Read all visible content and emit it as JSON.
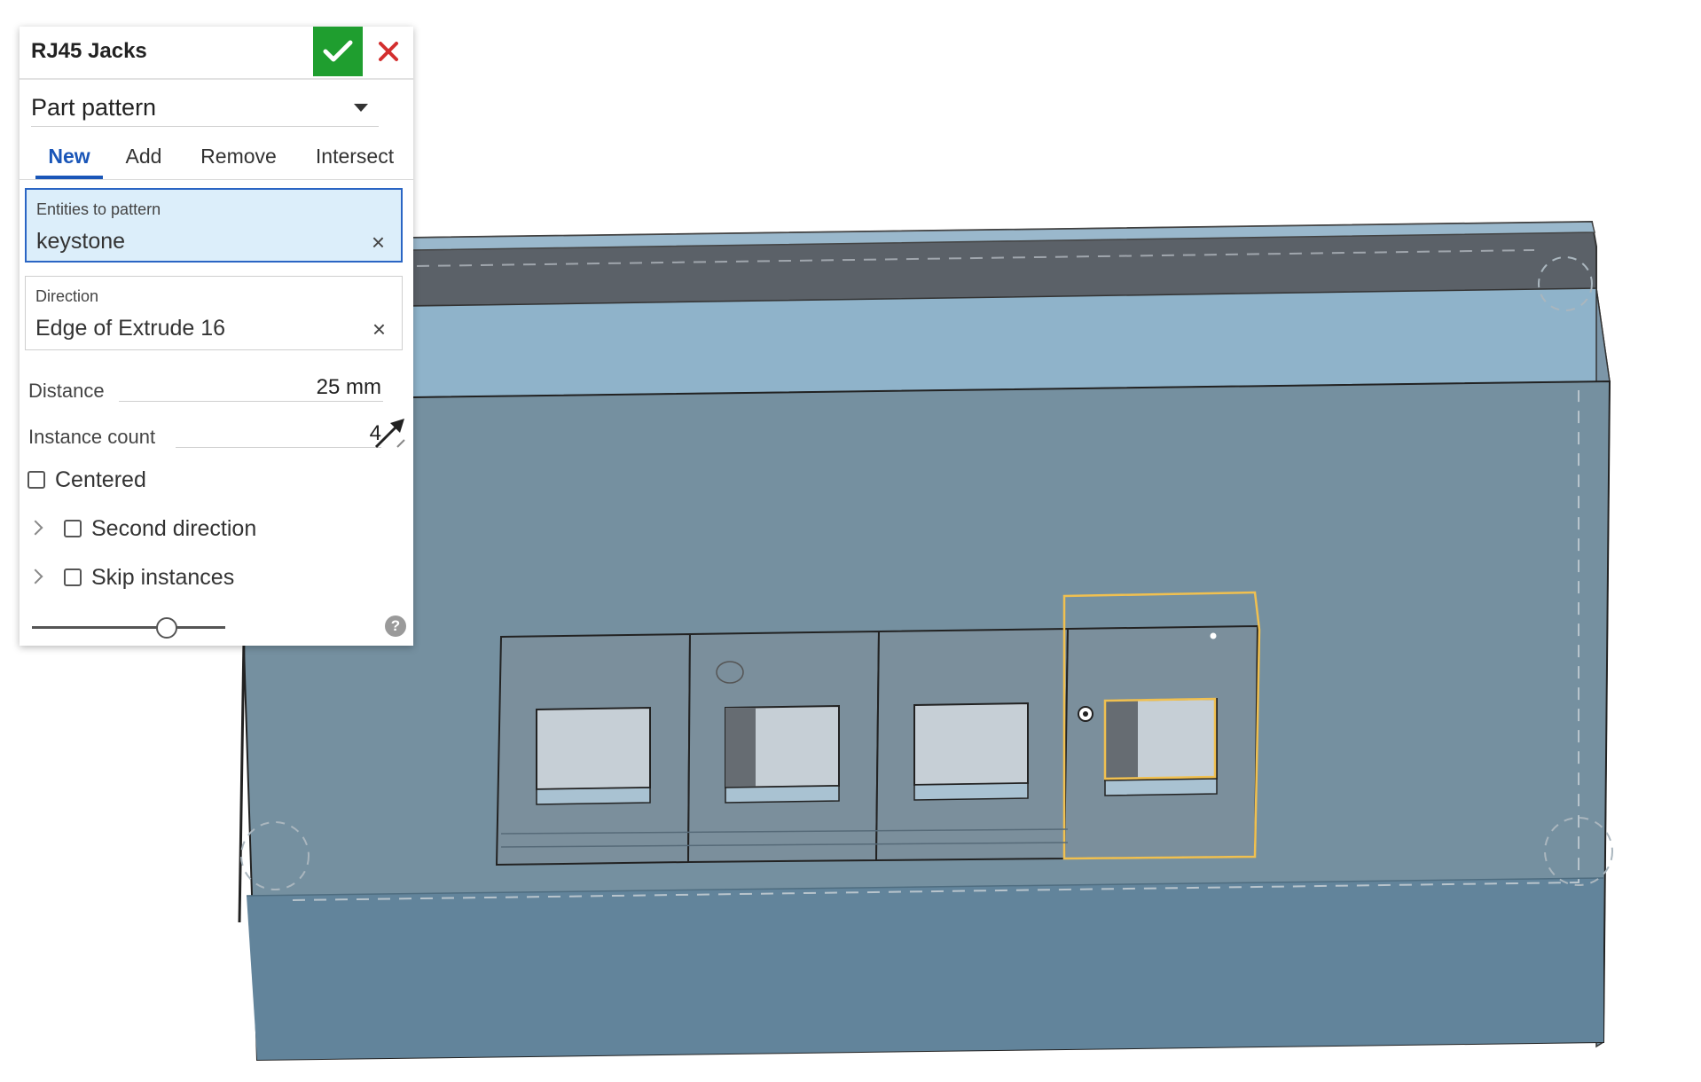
{
  "dialog": {
    "title": "RJ45 Jacks",
    "accept_icon": "check-icon",
    "cancel_icon": "close-icon",
    "pattern_type": "Part pattern",
    "tabs": [
      {
        "label": "New",
        "active": true
      },
      {
        "label": "Add",
        "active": false
      },
      {
        "label": "Remove",
        "active": false
      },
      {
        "label": "Intersect",
        "active": false
      }
    ],
    "entities": {
      "label": "Entities to pattern",
      "value": "keystone",
      "clear": "×"
    },
    "direction": {
      "label": "Direction",
      "value": "Edge of Extrude 16",
      "clear": "×"
    },
    "distance": {
      "label": "Distance",
      "value": "25 mm"
    },
    "instance_count": {
      "label": "Instance count",
      "value": "4"
    },
    "centered": {
      "label": "Centered",
      "checked": false
    },
    "second_direction": {
      "label": "Second direction",
      "checked": false
    },
    "skip_instances": {
      "label": "Skip instances",
      "checked": false
    },
    "help": "?"
  },
  "colors": {
    "accent": "#1a56b8",
    "accept": "#1f9e2f",
    "cancel": "#d32f2f",
    "part_face": "#7590a0",
    "part_top": "#90b4cc",
    "selection": "#f0c050"
  }
}
